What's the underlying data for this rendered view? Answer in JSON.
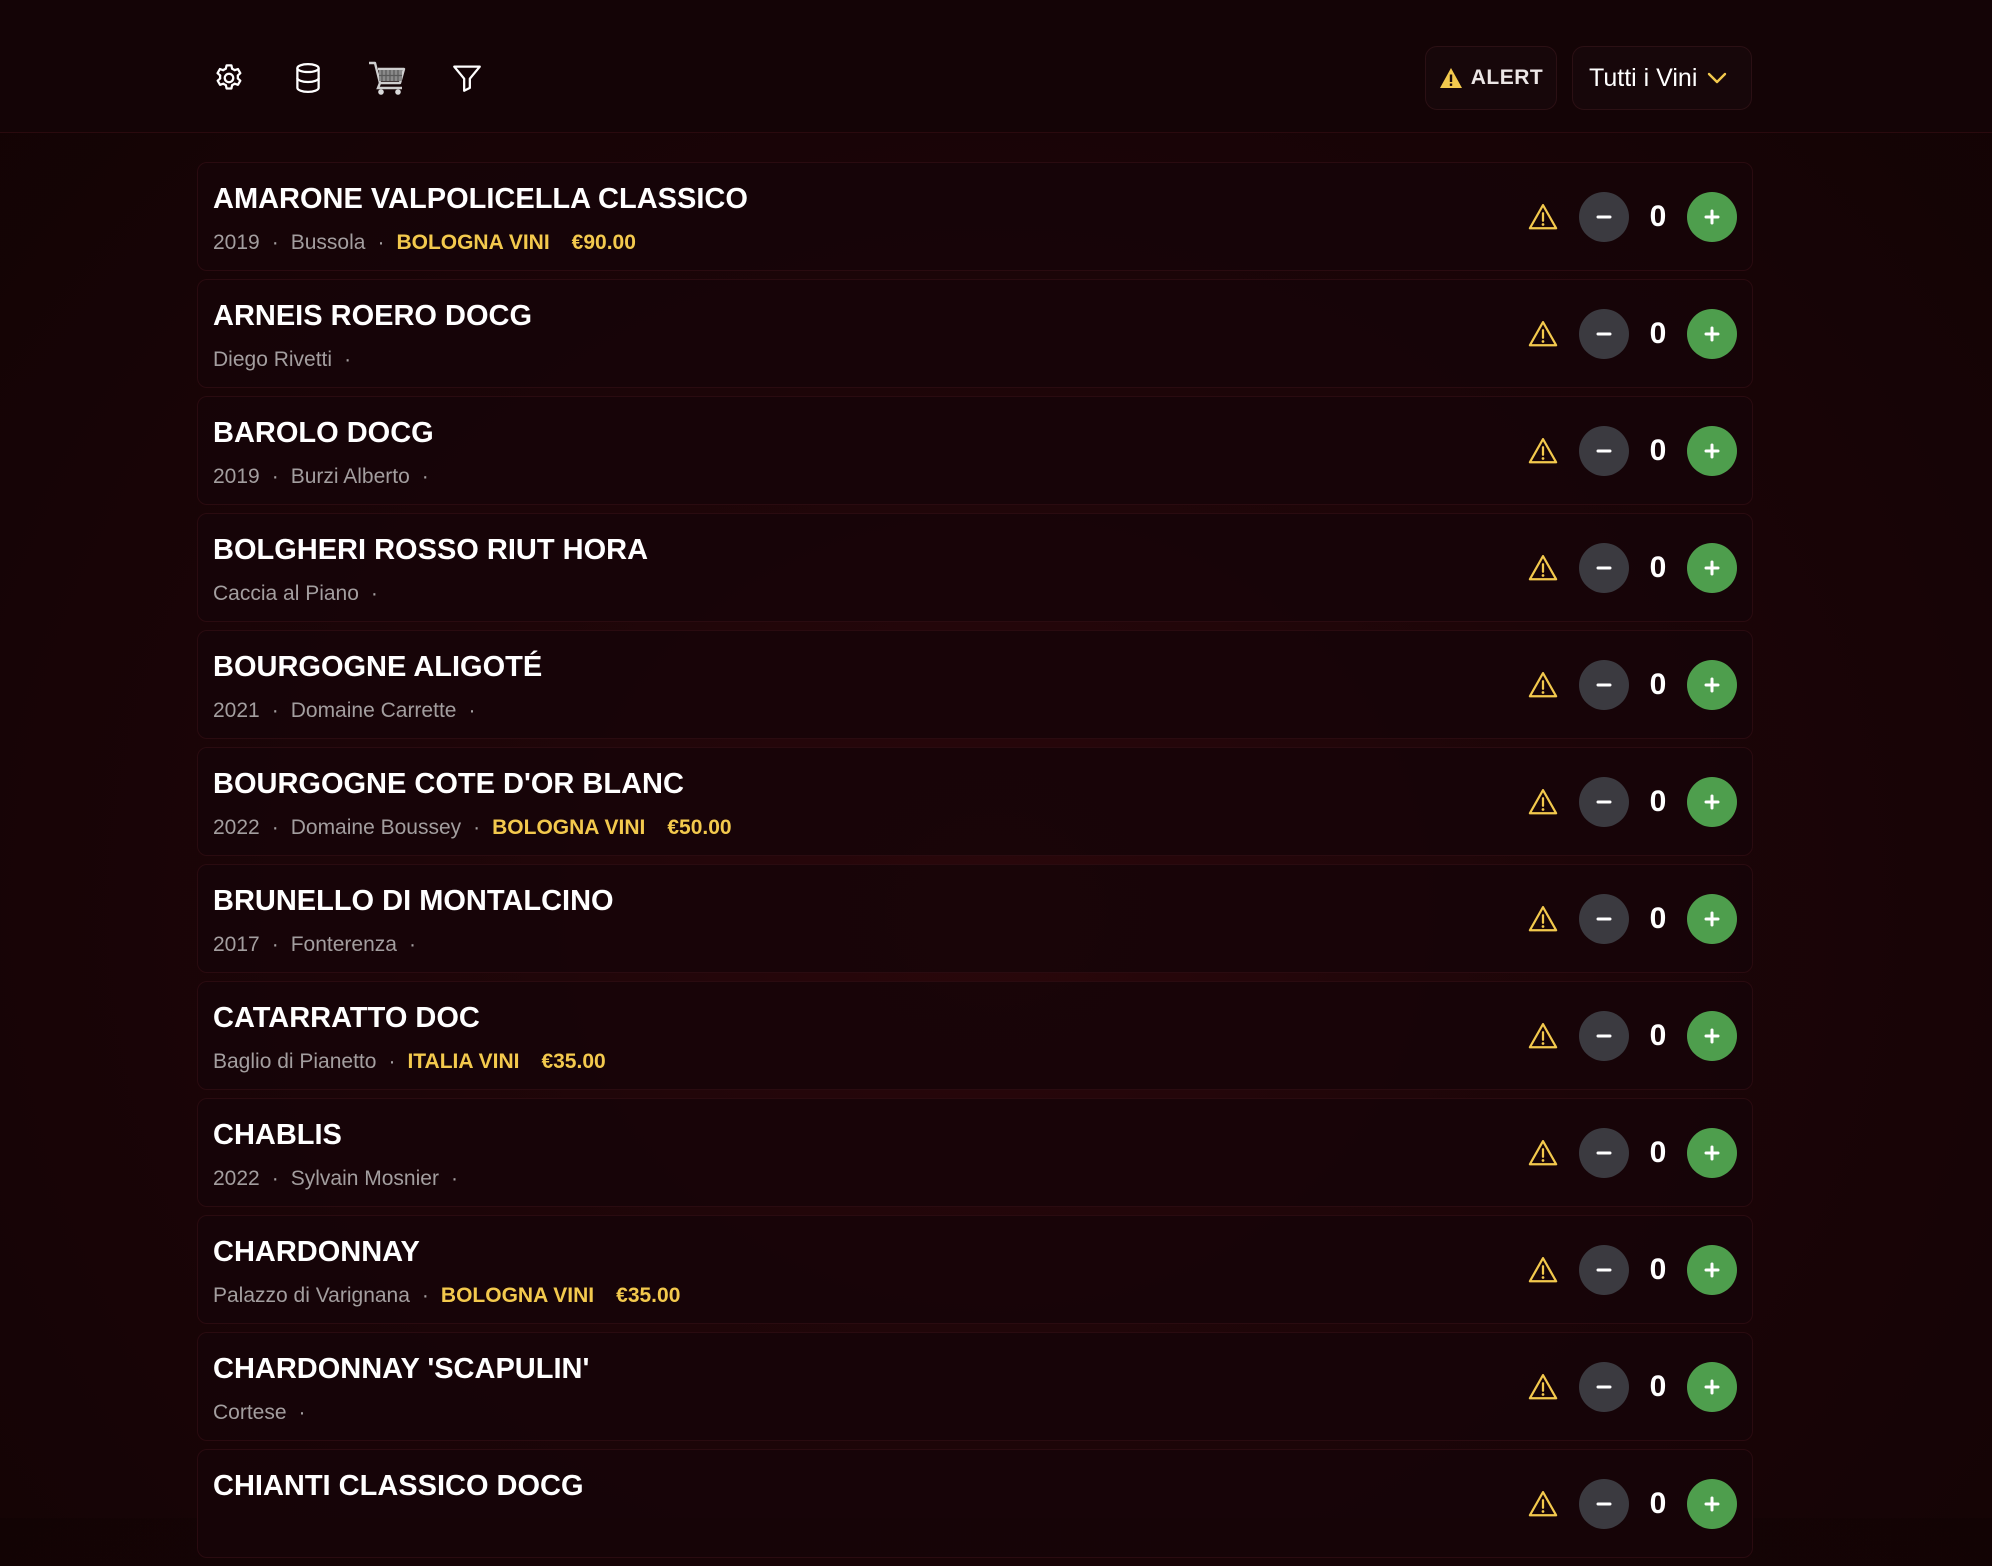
{
  "toolbar": {
    "icons": [
      "gear-icon",
      "database-icon",
      "shopping-cart-icon",
      "filter-icon"
    ],
    "alert_label": "ALERT",
    "filter_value": "Tutti i Vini"
  },
  "colors": {
    "accent_yellow": "#f3c94d",
    "plus_green": "#4e9e4d",
    "minus_gray": "#3b3a40",
    "background": "#1c0508"
  },
  "wines": [
    {
      "name": "AMARONE VALPOLICELLA CLASSICO",
      "year": "2019",
      "producer": "Bussola",
      "supplier": "BOLOGNA VINI",
      "price": "€90.00",
      "qty": "0"
    },
    {
      "name": "ARNEIS ROERO DOCG",
      "year": "",
      "producer": "Diego Rivetti",
      "supplier": "",
      "price": "",
      "qty": "0"
    },
    {
      "name": "BAROLO DOCG",
      "year": "2019",
      "producer": "Burzi Alberto",
      "supplier": "",
      "price": "",
      "qty": "0"
    },
    {
      "name": "BOLGHERI ROSSO RIUT HORA",
      "year": "",
      "producer": "Caccia al Piano",
      "supplier": "",
      "price": "",
      "qty": "0"
    },
    {
      "name": "BOURGOGNE ALIGOTÉ",
      "year": "2021",
      "producer": "Domaine Carrette",
      "supplier": "",
      "price": "",
      "qty": "0"
    },
    {
      "name": "BOURGOGNE COTE D'OR BLANC",
      "year": "2022",
      "producer": "Domaine Boussey",
      "supplier": "BOLOGNA VINI",
      "price": "€50.00",
      "qty": "0"
    },
    {
      "name": "BRUNELLO DI MONTALCINO",
      "year": "2017",
      "producer": "Fonterenza",
      "supplier": "",
      "price": "",
      "qty": "0"
    },
    {
      "name": "CATARRATTO DOC",
      "year": "",
      "producer": "Baglio di Pianetto",
      "supplier": "ITALIA VINI",
      "price": "€35.00",
      "qty": "0"
    },
    {
      "name": "CHABLIS",
      "year": "2022",
      "producer": "Sylvain Mosnier",
      "supplier": "",
      "price": "",
      "qty": "0"
    },
    {
      "name": "CHARDONNAY",
      "year": "",
      "producer": "Palazzo di Varignana",
      "supplier": "BOLOGNA VINI",
      "price": "€35.00",
      "qty": "0"
    },
    {
      "name": "CHARDONNAY 'SCAPULIN'",
      "year": "",
      "producer": "Cortese",
      "supplier": "",
      "price": "",
      "qty": "0"
    },
    {
      "name": "CHIANTI CLASSICO DOCG",
      "year": "",
      "producer": "",
      "supplier": "",
      "price": "",
      "qty": "0"
    }
  ]
}
